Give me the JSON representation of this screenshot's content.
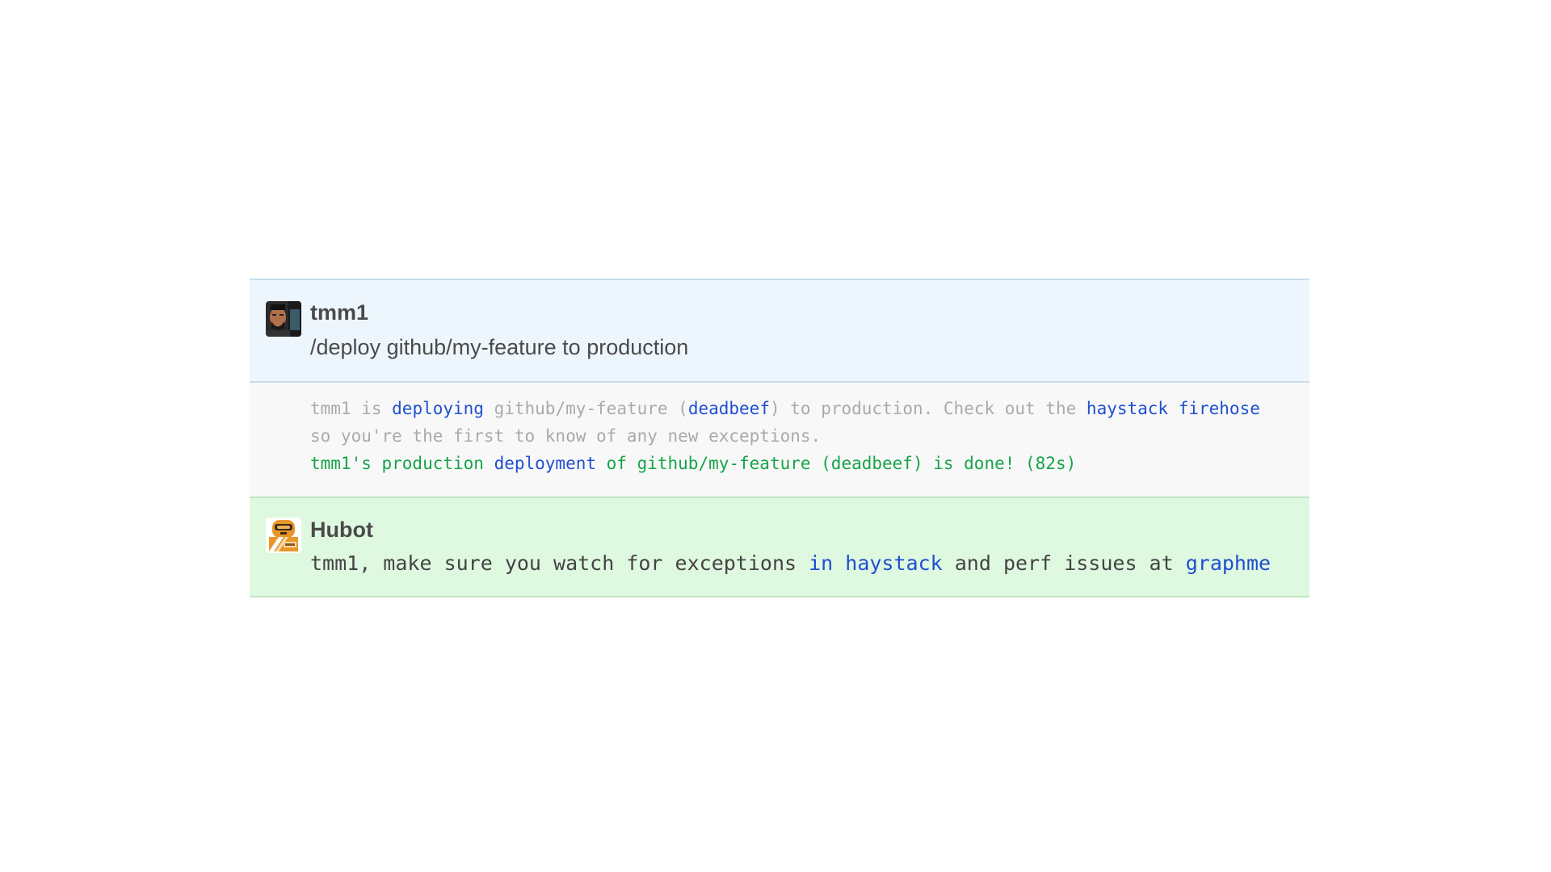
{
  "messages": {
    "user": {
      "author": "tmm1",
      "text": "/deploy github/my-feature to production",
      "avatar_icon": "user-avatar-icon"
    },
    "system": {
      "line1": {
        "user": "tmm1",
        "is": " is ",
        "deploying_link": "deploying",
        "repo_open": " github/my-feature (",
        "sha_link": "deadbeef",
        "after_sha": ") to production. Check out the ",
        "firehose_link": "haystack firehose"
      },
      "line2": "so you're the first to know of any new exceptions.",
      "line3": {
        "before": "tmm1's production ",
        "deployment_link": "deployment",
        "after": " of github/my-feature (deadbeef) is done! (82s)"
      }
    },
    "bot": {
      "author": "Hubot",
      "avatar_icon": "hubot-avatar-icon",
      "text_before": "tmm1, make sure you watch for exceptions ",
      "haystack_link": "in haystack",
      "text_middle": " and perf issues at ",
      "graphme_link": "graphme"
    }
  },
  "colors": {
    "link": "#1f4fd1",
    "success": "#17a34a",
    "muted": "#aaaaaa",
    "user_bg": "#eef6fd",
    "bot_bg": "#dff8e0"
  }
}
